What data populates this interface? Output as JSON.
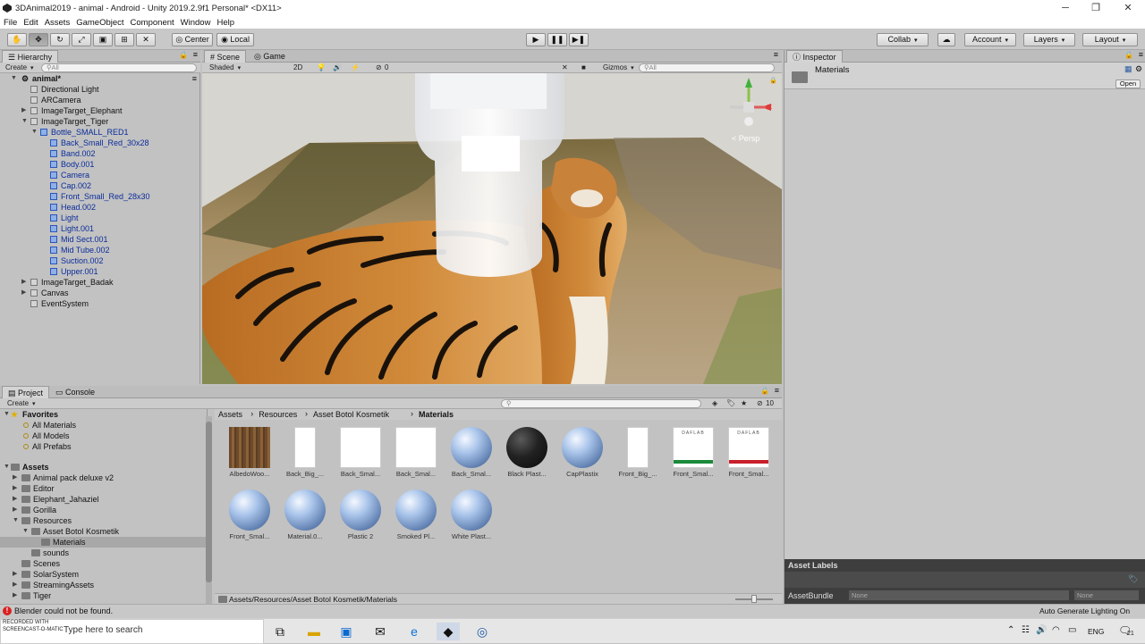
{
  "window": {
    "title": "3DAnimal2019 - animal - Android - Unity 2019.2.9f1 Personal* <DX11>"
  },
  "menu": [
    "File",
    "Edit",
    "Assets",
    "GameObject",
    "Component",
    "Window",
    "Help"
  ],
  "toolbar": {
    "pivot": "Center",
    "space": "Local",
    "collab": "Collab",
    "account": "Account",
    "layers": "Layers",
    "layout": "Layout"
  },
  "hierarchy": {
    "tab": "Hierarchy",
    "create": "Create",
    "search_placeholder": "All",
    "scene": "animal*",
    "items": [
      {
        "label": "Directional Light",
        "depth": 1,
        "blue": false,
        "arrow": ""
      },
      {
        "label": "ARCamera",
        "depth": 1,
        "blue": false,
        "arrow": ""
      },
      {
        "label": "ImageTarget_Elephant",
        "depth": 1,
        "blue": false,
        "arrow": "right"
      },
      {
        "label": "ImageTarget_Tiger",
        "depth": 1,
        "blue": false,
        "arrow": "down"
      },
      {
        "label": "Bottle_SMALL_RED1",
        "depth": 2,
        "blue": true,
        "arrow": "down"
      },
      {
        "label": "Back_Small_Red_30x28",
        "depth": 3,
        "blue": true,
        "arrow": ""
      },
      {
        "label": "Band.002",
        "depth": 3,
        "blue": true,
        "arrow": ""
      },
      {
        "label": "Body.001",
        "depth": 3,
        "blue": true,
        "arrow": ""
      },
      {
        "label": "Camera",
        "depth": 3,
        "blue": true,
        "arrow": ""
      },
      {
        "label": "Cap.002",
        "depth": 3,
        "blue": true,
        "arrow": ""
      },
      {
        "label": "Front_Small_Red_28x30",
        "depth": 3,
        "blue": true,
        "arrow": ""
      },
      {
        "label": "Head.002",
        "depth": 3,
        "blue": true,
        "arrow": ""
      },
      {
        "label": "Light",
        "depth": 3,
        "blue": true,
        "arrow": ""
      },
      {
        "label": "Light.001",
        "depth": 3,
        "blue": true,
        "arrow": ""
      },
      {
        "label": "Mid Sect.001",
        "depth": 3,
        "blue": true,
        "arrow": ""
      },
      {
        "label": "Mid Tube.002",
        "depth": 3,
        "blue": true,
        "arrow": ""
      },
      {
        "label": "Suction.002",
        "depth": 3,
        "blue": true,
        "arrow": ""
      },
      {
        "label": "Upper.001",
        "depth": 3,
        "blue": true,
        "arrow": ""
      },
      {
        "label": "ImageTarget_Badak",
        "depth": 1,
        "blue": false,
        "arrow": "right"
      },
      {
        "label": "Canvas",
        "depth": 1,
        "blue": false,
        "arrow": "right"
      },
      {
        "label": "EventSystem",
        "depth": 1,
        "blue": false,
        "arrow": ""
      }
    ]
  },
  "scene": {
    "tab_scene": "Scene",
    "tab_game": "Game",
    "shading": "Shaded",
    "mode2d": "2D",
    "gizmos": "Gizmos",
    "search_placeholder": "All",
    "persp": "< Persp",
    "fx_count": "0"
  },
  "project": {
    "tab_project": "Project",
    "tab_console": "Console",
    "create": "Create",
    "favorites": "Favorites",
    "fav_items": [
      "All Materials",
      "All Models",
      "All Prefabs"
    ],
    "assets": "Assets",
    "tree": [
      {
        "label": "Animal pack deluxe v2",
        "depth": 1,
        "arrow": "right"
      },
      {
        "label": "Editor",
        "depth": 1,
        "arrow": "right"
      },
      {
        "label": "Elephant_Jahaziel",
        "depth": 1,
        "arrow": "right"
      },
      {
        "label": "Gorilla",
        "depth": 1,
        "arrow": "right"
      },
      {
        "label": "Resources",
        "depth": 1,
        "arrow": "down"
      },
      {
        "label": "Asset Botol Kosmetik",
        "depth": 2,
        "arrow": "down"
      },
      {
        "label": "Materials",
        "depth": 3,
        "arrow": ""
      },
      {
        "label": "sounds",
        "depth": 2,
        "arrow": ""
      },
      {
        "label": "Scenes",
        "depth": 1,
        "arrow": ""
      },
      {
        "label": "SolarSystem",
        "depth": 1,
        "arrow": "right"
      },
      {
        "label": "StreamingAssets",
        "depth": 1,
        "arrow": "right"
      },
      {
        "label": "Tiger",
        "depth": 1,
        "arrow": "right"
      }
    ],
    "breadcrumb": [
      "Assets",
      "Resources",
      "Asset Botol Kosmetik",
      "Materials"
    ],
    "count": "10",
    "assets_grid": [
      {
        "label": "AlbedoWoo...",
        "kind": "wood"
      },
      {
        "label": "Back_Big_...",
        "kind": "label-narrow"
      },
      {
        "label": "Back_Smal...",
        "kind": "white"
      },
      {
        "label": "Back_Smal...",
        "kind": "white"
      },
      {
        "label": "Back_Smal...",
        "kind": "sphere"
      },
      {
        "label": "Black Plast...",
        "kind": "black"
      },
      {
        "label": "CapPlastix",
        "kind": "sphere"
      },
      {
        "label": "Front_Big_...",
        "kind": "label-narrow"
      },
      {
        "label": "Front_Smal...",
        "kind": "label"
      },
      {
        "label": "Front_Smal...",
        "kind": "label"
      },
      {
        "label": "Front_Smal...",
        "kind": "sphere"
      },
      {
        "label": "Material.0...",
        "kind": "sphere"
      },
      {
        "label": "Plastic 2",
        "kind": "sphere"
      },
      {
        "label": "Smoked Pl...",
        "kind": "sphere"
      },
      {
        "label": "White Plast...",
        "kind": "sphere"
      }
    ],
    "path": "Assets/Resources/Asset Botol Kosmetik/Materials",
    "label_brand": "DAFLAB"
  },
  "inspector": {
    "tab": "Inspector",
    "title": "Materials",
    "open": "Open",
    "asset_labels": "Asset Labels",
    "asset_bundle": "AssetBundle",
    "none1": "None",
    "none2": "None"
  },
  "status": {
    "error": "Blender could not be found.",
    "right": "Auto Generate Lighting On"
  },
  "taskbar": {
    "search": "Type here to search",
    "watermark": "RECORDED WITH SCREENCAST-O-MATIC",
    "lang": "ENG",
    "notif": "21"
  }
}
